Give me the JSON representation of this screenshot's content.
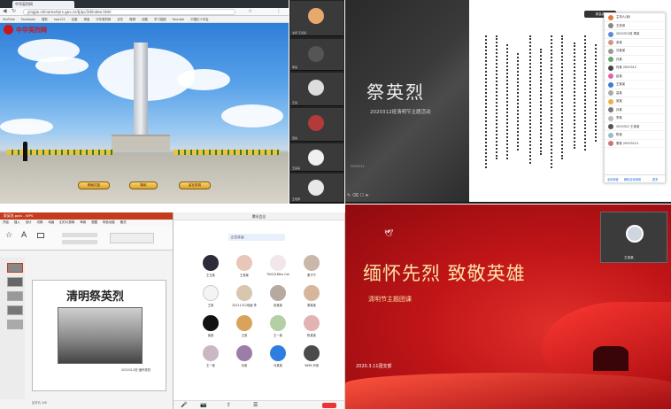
{
  "q1": {
    "tab_title": "中华英烈网",
    "url": "yingjie.chinamartyrs.gov.cn/tj/pc/3d/index.html",
    "bookmarks": [
      "YouTube",
      "Facebook",
      "搜狗",
      "hao123",
      "百度",
      "淘宝",
      "中华英烈网",
      "京东",
      "微博",
      "优酷",
      "学习强国",
      "Youtube",
      "中国红十字会"
    ],
    "logo": "中华英烈网",
    "buttons": [
      "敬献花篮",
      "鞠躬",
      "留言祭奠"
    ]
  },
  "video": {
    "tiles": [
      "主持 王某某",
      "李某",
      "王某",
      "田某",
      "王某某",
      "王老师",
      "王某"
    ]
  },
  "q2": {
    "slide_title": "祭英烈",
    "slide_subtitle": "2020312班清明节主题活动",
    "slide_footer": "2020312",
    "panel_title": "参会者",
    "participants": [
      "主持人(我)",
      "王老师",
      "2020312班 周某",
      "张某",
      "刘某某",
      "孙某",
      "何某 2020312",
      "赵某",
      "王某某",
      "高某",
      "吴某",
      "孙某",
      "李某",
      "2020312 王某某",
      "陈某",
      "董某 20203121"
    ],
    "panel_buttons": [
      "全体静音",
      "解除全体静音",
      "更多"
    ]
  },
  "q3": {
    "window_title": "祭英烈.pptx - WPS",
    "menu": [
      "开始",
      "插入",
      "设计",
      "切换",
      "动画",
      "幻灯片放映",
      "审阅",
      "视图",
      "特色功能",
      "格式"
    ],
    "slide_title": "清明祭英烈",
    "caption": "2020312班·缅怀英烈",
    "status": "幻灯片 2/8"
  },
  "q4": {
    "title": "腾讯会议",
    "speaking": "正在讲话:",
    "tiles": [
      "王玉某",
      "王某某",
      "Tfd2216fho Cat",
      "董子宁",
      "王某",
      "20211312班级 李",
      "张某某",
      "周某某",
      "吴某",
      "王某",
      "王一某",
      "陈某某",
      "王一某",
      "孙某",
      "马某某",
      "5698 邓某"
    ]
  },
  "q5": {
    "headline": "缅怀先烈  致敬英雄",
    "subtitle": "清明节主题团课",
    "date": "2020.3.11团支部",
    "camera_name": "王某某"
  }
}
